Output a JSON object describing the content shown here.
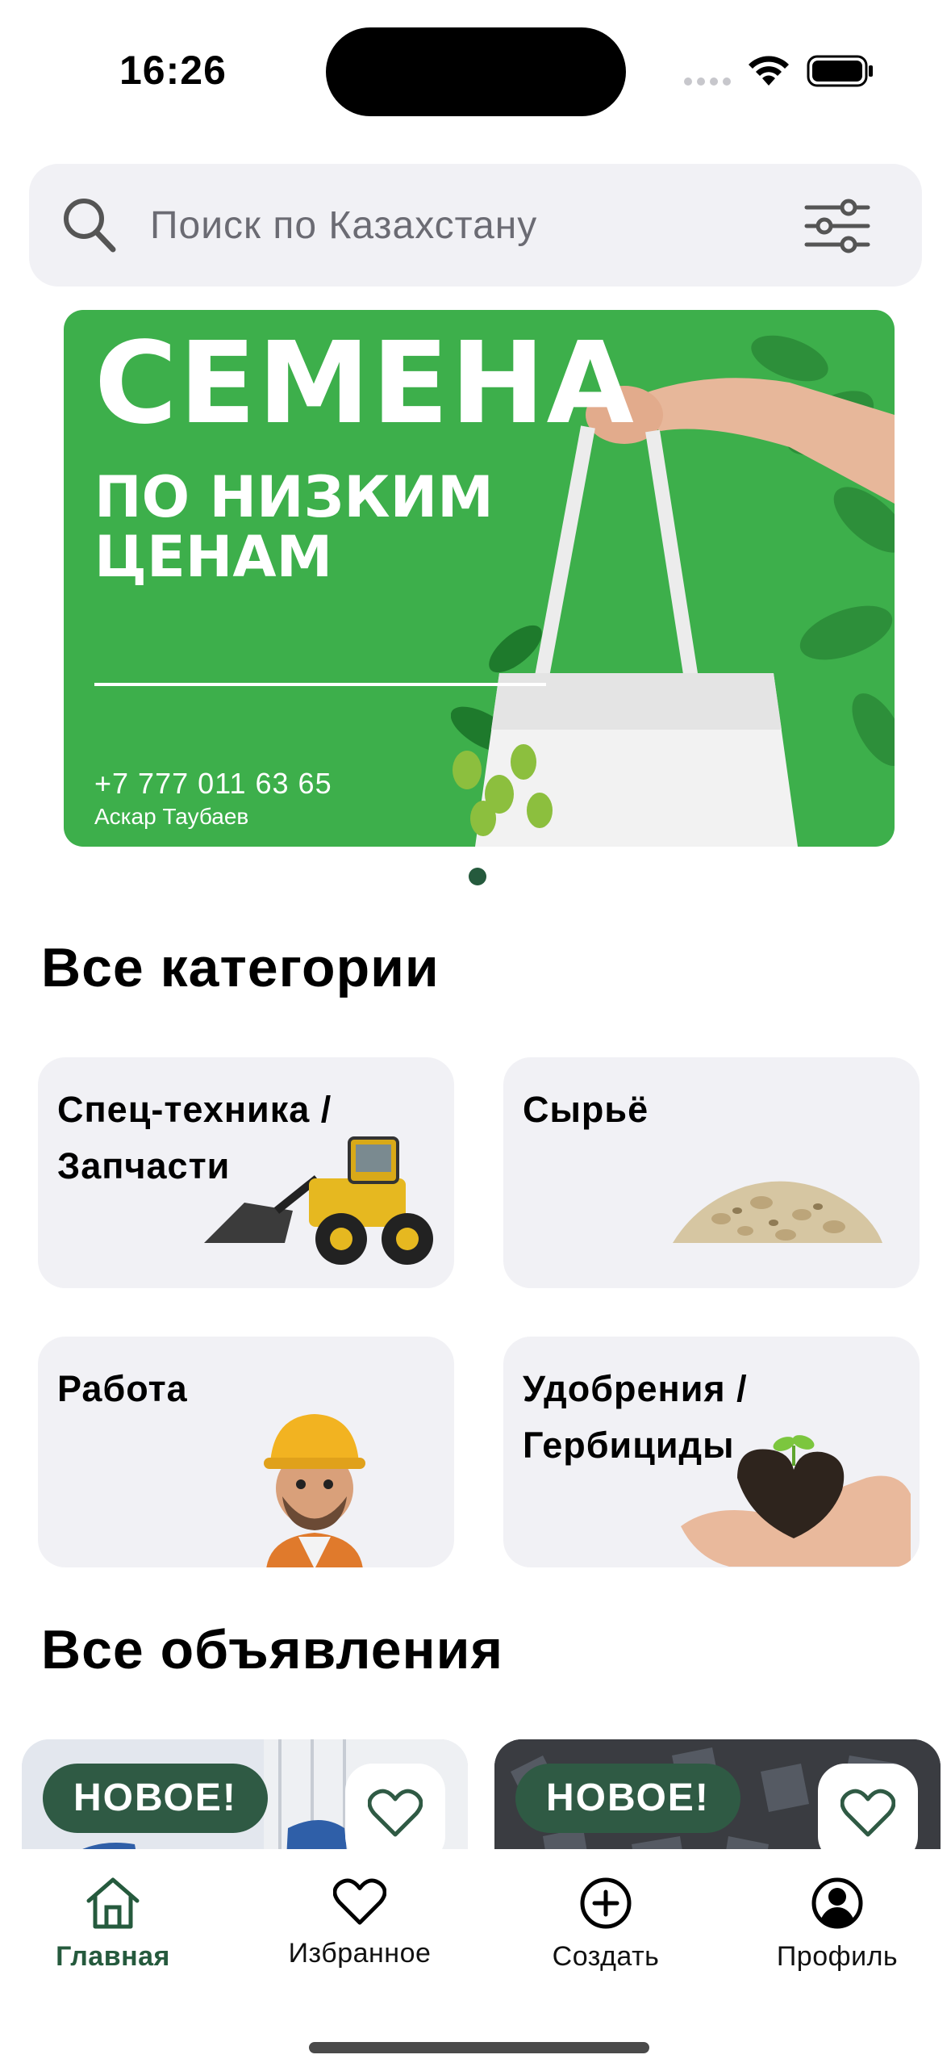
{
  "status_bar": {
    "time": "16:26"
  },
  "search": {
    "placeholder": "Поиск по Казахстану"
  },
  "banner": {
    "title": "СЕМЕНА",
    "subtitle": "ПО НИЗКИМ ЦЕНАМ",
    "phone": "+7 777 011 63 65",
    "contact_name": "Аскар Таубаев",
    "background_color": "#3daf4b"
  },
  "categories": {
    "title": "Все категории",
    "items": [
      {
        "label": "Спец-техника / Запчасти",
        "line1": "Спец-техника /",
        "line2": "Запчасти",
        "icon": "loader-icon"
      },
      {
        "label": "Сырьё",
        "line1": "Сырьё",
        "line2": "",
        "icon": "raw-material-icon"
      },
      {
        "label": "Работа",
        "line1": "Работа",
        "line2": "",
        "icon": "worker-icon"
      },
      {
        "label": "Удобрения / Гербициды",
        "line1": "Удобрения /",
        "line2": "Гербициды",
        "icon": "soil-heart-icon"
      }
    ]
  },
  "listings": {
    "title": "Все объявления",
    "items": [
      {
        "badge": "НОВОЕ!"
      },
      {
        "badge": "НОВОЕ!"
      }
    ]
  },
  "tab_bar": {
    "items": [
      {
        "label": "Главная",
        "icon": "home-icon",
        "active": true
      },
      {
        "label": "Избранное",
        "icon": "heart-icon",
        "active": false
      },
      {
        "label": "Создать",
        "icon": "plus-circle-icon",
        "active": false
      },
      {
        "label": "Профиль",
        "icon": "profile-icon",
        "active": false
      }
    ]
  },
  "colors": {
    "accent": "#255a3d",
    "card_bg": "#f1f1f5",
    "badge_bg": "#2f5a44"
  }
}
